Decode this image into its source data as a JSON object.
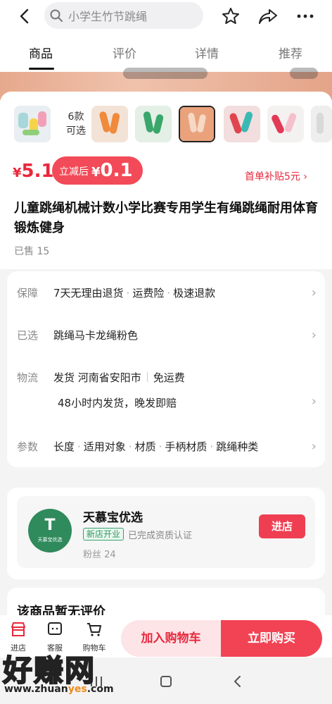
{
  "header": {
    "search_placeholder": "小学生竹节跳绳"
  },
  "tabs": [
    {
      "label": "商品",
      "active": true
    },
    {
      "label": "评价",
      "active": false
    },
    {
      "label": "详情",
      "active": false
    },
    {
      "label": "推荐",
      "active": false
    }
  ],
  "product": {
    "variant_count": "6款",
    "variant_suffix": "可选",
    "thumb_colors": [
      "#a7d7d8",
      "#f08a3c",
      "#3aa66b",
      "#f0a36c",
      "#e0454f",
      "#f5c0cc",
      "#e7e7e7"
    ],
    "price_currency": "¥",
    "price": "5.1",
    "coupon_label": "立减后",
    "coupon_currency": "¥",
    "coupon_price": "0.1",
    "subsidy": "首单补贴5元 ›",
    "title": "儿童跳绳机械计数小学比赛专用学生有绳跳绳耐用体育锻炼健身",
    "sold": "已售 15"
  },
  "info": {
    "guarantee_label": "保障",
    "guarantee_items": [
      "7天无理由退货",
      "运费险",
      "极速退款"
    ],
    "selected_label": "已选",
    "selected_value": "跳绳马卡龙绳粉色",
    "logistics_label": "物流",
    "ship_from": "发货 河南省安阳市",
    "shipping_fee": "免运费",
    "ship_promise": "48小时内发货，晚发即赔",
    "params_label": "参数",
    "params_items": [
      "长度",
      "适用对象",
      "材质",
      "手柄材质",
      "跳绳种类"
    ]
  },
  "store": {
    "logo_letter": "T",
    "logo_text": "天慕宝优选",
    "name": "天慕宝优选",
    "badge_new": "新店开业",
    "badge_cert": "已完成资质认证",
    "fans": "粉丝 24",
    "enter_label": "进店"
  },
  "reviews": {
    "title": "该商品暂无评价"
  },
  "bottom_bar": {
    "store_label": "进店",
    "service_label": "客服",
    "cart_label": "购物车",
    "add_cart": "加入购物车",
    "buy_now": "立即购买"
  },
  "watermark": {
    "big": "好赚网",
    "url_a": "www.zhuan",
    "url_b": "yes",
    "url_c": ".com"
  },
  "colors": {
    "accent": "#e8283c",
    "button": "#f14354",
    "store_green": "#2f8a5c"
  }
}
